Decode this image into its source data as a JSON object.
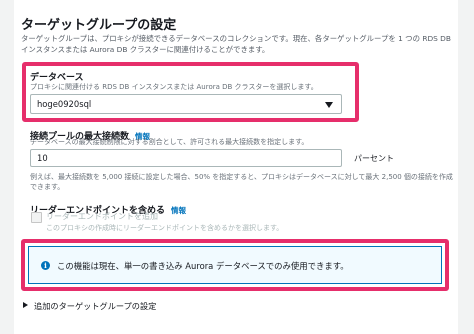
{
  "section": {
    "title": "ターゲットグループの設定",
    "description_line1": "ターゲットグループは、プロキシが接続できるデータベースのコレクションです。現在、各ターゲットグループを 1 つの RDS DB",
    "description_line2": "インスタンスまたは Aurora DB クラスターに関連付けることができます。"
  },
  "database": {
    "label": "データベース",
    "hint": "プロキシに関連付ける RDS DB インスタンスまたは Aurora DB クラスターを選択します。",
    "selected": "hoge0920sql"
  },
  "max_connections": {
    "label": "接続プールの最大接続数",
    "info": "情報",
    "hint": "データベースの最大接続制限に対する割合として、許可される最大接続数を指定します。",
    "value": "10",
    "unit": "パーセント",
    "example_line1": "例えば、最大接続数を 5,000 接続に設定した場合、50% を指定すると、プロキシはデータベースに対して最大 2,500 個の接続を作成",
    "example_line2": "できます。"
  },
  "reader_endpoint": {
    "label": "リーダーエンドポイントを含める",
    "info": "情報",
    "checkbox_label": "リーダーエンドポイントを追加",
    "checkbox_hint": "このプロキシの作成時にリーダーエンドポイントを含めるかを選択します。",
    "checked": false
  },
  "alert": {
    "icon": "info-icon",
    "text": "この機能は現在、単一の書き込み Aurora データベースでのみ使用できます。"
  },
  "expander": {
    "label": "追加のターゲットグループの設定"
  },
  "colors": {
    "highlight": "#e62e6b",
    "link": "#0073bb",
    "alert_bg": "#f1faff"
  }
}
